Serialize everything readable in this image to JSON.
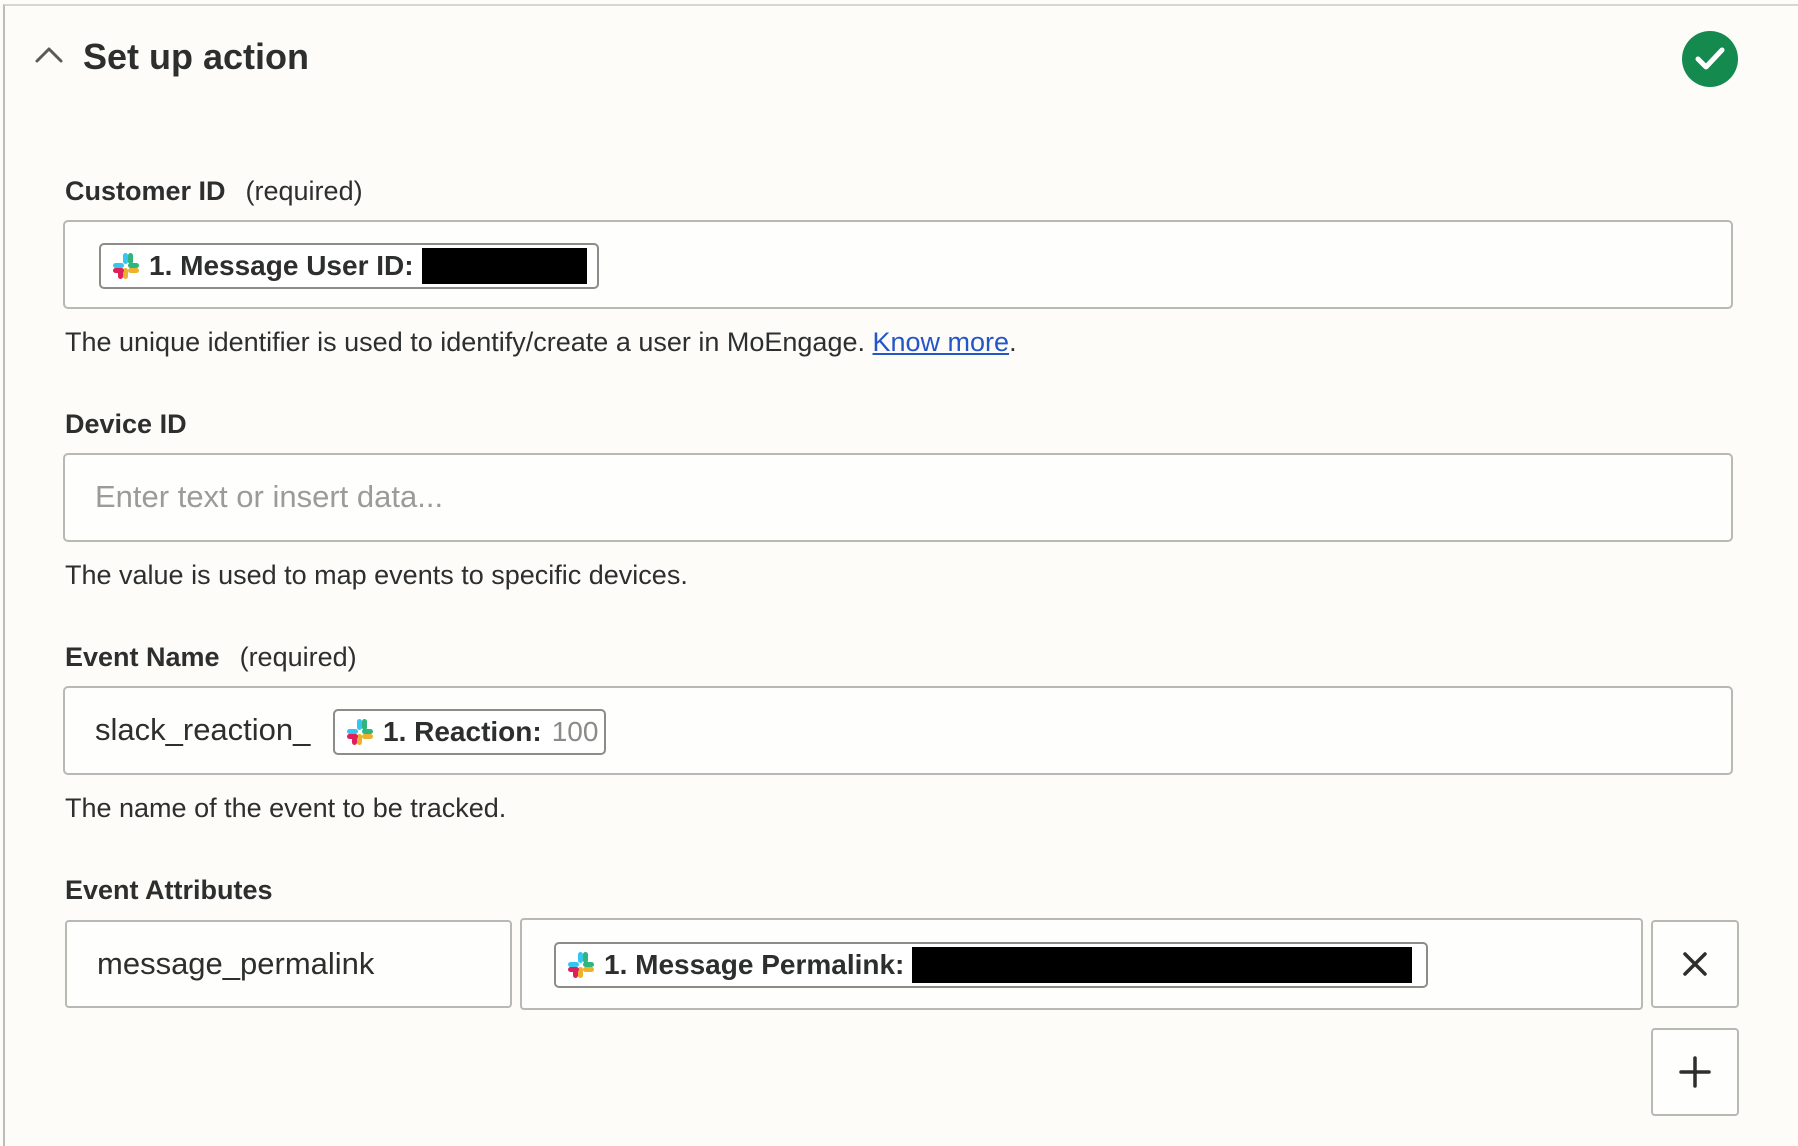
{
  "section": {
    "title": "Set up action",
    "status": "complete",
    "status_color": "#148a4e"
  },
  "customer_id": {
    "label": "Customer ID",
    "required_label": "(required)",
    "pill_label": "1. Message User ID:",
    "pill_icon": "slack-icon",
    "help_text": "The unique identifier is used to identify/create a user in MoEngage.",
    "help_link": "Know more",
    "help_suffix": "."
  },
  "device_id": {
    "label": "Device ID",
    "placeholder": "Enter text or insert data...",
    "help_text": "The value is used to map events to specific devices."
  },
  "event_name": {
    "label": "Event Name",
    "required_label": "(required)",
    "prefix_text": "slack_reaction_",
    "pill_label": "1. Reaction:",
    "pill_value": "100",
    "pill_icon": "slack-icon",
    "help_text": "The name of the event to be tracked."
  },
  "event_attributes": {
    "label": "Event Attributes",
    "rows": [
      {
        "key": "message_permalink",
        "pill_label": "1. Message Permalink:",
        "pill_icon": "slack-icon"
      }
    ],
    "remove_icon": "close-icon",
    "add_icon": "plus-icon"
  },
  "colors": {
    "link": "#2456c8",
    "background": "#fdfcf9"
  }
}
